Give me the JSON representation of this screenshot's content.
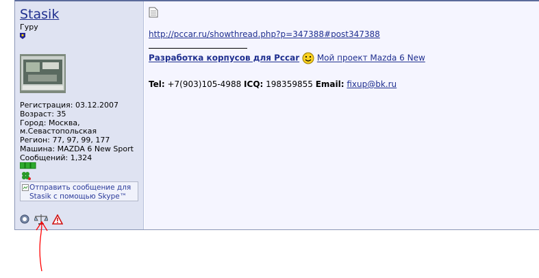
{
  "user": {
    "name": "Stasik",
    "rank": "Гуру",
    "info": [
      "Регистрация: 03.12.2007",
      "Возраст: 35",
      "Город: Москва,",
      "м.Севастопольская",
      "Регион: 77, 97, 99, 177",
      "Машина: MAZDA 6 New Sport",
      "Сообщений: 1,324"
    ],
    "skype_alt_line1": "Отправить сообщение для",
    "skype_alt_line2": "Stasik с помощью Skype™"
  },
  "post": {
    "url": "http://pccar.ru/showthread.php?p=347388#post347388",
    "sig_link_bold": "Разработка корпусов для Pccar",
    "sig_link_project": " Мой проект Mazda 6 New",
    "tel_label": "Tel:",
    "tel_value": "+7(903)105-4988",
    "icq_label": "ICQ:",
    "icq_value": "198359855",
    "email_label": "Email:",
    "email_value": "fixup@bk.ru"
  },
  "icons": [
    "post-doc-icon",
    "rank-pip-icon",
    "reputation-icon",
    "clover-icon",
    "skype-image",
    "online-status-icon",
    "scales-icon",
    "report-warning-icon",
    "smiley-icon"
  ],
  "colors": {
    "link": "#1f2f8f",
    "userpane_bg": "#dfe3f2",
    "content_bg": "#f5f5ff",
    "annotation": "#ff0000"
  }
}
